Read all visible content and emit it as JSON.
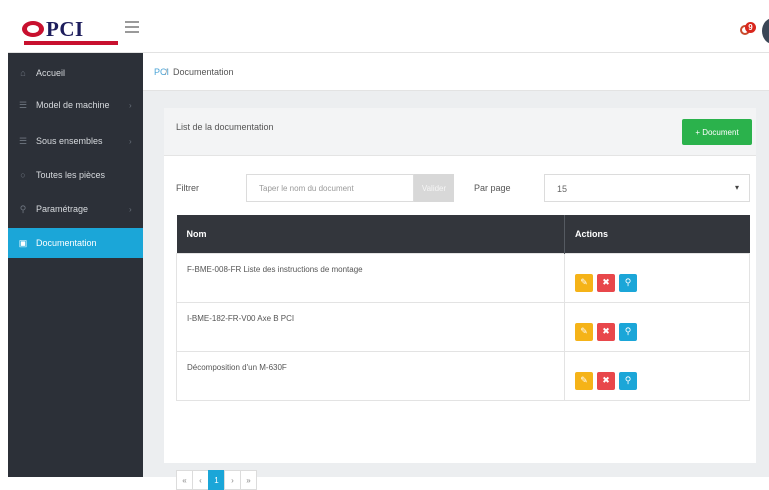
{
  "header": {
    "logo_text": "PCI",
    "notification_count": "9"
  },
  "sidebar": {
    "items": [
      {
        "label": "Accueil",
        "icon": "home-icon",
        "has_submenu": false,
        "active": false
      },
      {
        "label": "Model de machine",
        "icon": "list-icon",
        "has_submenu": true,
        "active": false
      },
      {
        "label": "Sous ensembles",
        "icon": "list-icon",
        "has_submenu": true,
        "active": false
      },
      {
        "label": "Toutes les pièces",
        "icon": "circle-icon",
        "has_submenu": false,
        "active": false
      },
      {
        "label": "Paramétrage",
        "icon": "wrench-icon",
        "has_submenu": true,
        "active": false
      },
      {
        "label": "Documentation",
        "icon": "document-icon",
        "has_submenu": false,
        "active": true
      }
    ]
  },
  "breadcrumb": {
    "root": "PCI",
    "separator": "/",
    "current": "Documentation"
  },
  "card": {
    "title": "List de la documentation",
    "add_button": "+ Document"
  },
  "filter": {
    "label": "Filtrer",
    "placeholder": "Taper le nom du document",
    "button": "Valider",
    "per_page_label": "Par page",
    "per_page_value": "15"
  },
  "table": {
    "columns": [
      "Nom",
      "Actions"
    ],
    "rows": [
      {
        "name": "F-BME-008-FR Liste des instructions de montage"
      },
      {
        "name": "I-BME-182-FR-V00 Axe B PCI"
      },
      {
        "name": "Décomposition d'un M-630F"
      }
    ],
    "action_icons": [
      "edit-icon",
      "delete-icon",
      "search-icon"
    ]
  },
  "pagination": {
    "first": "«",
    "prev": "‹",
    "current": "1",
    "next": "›",
    "last": "»"
  },
  "colors": {
    "sidebar_bg": "#2c3038",
    "active_accent": "#1ba6d8",
    "add_button": "#2bb24c",
    "edit": "#f5b318",
    "delete": "#e8474b",
    "view": "#1ba6d8",
    "table_header": "#33363c"
  }
}
